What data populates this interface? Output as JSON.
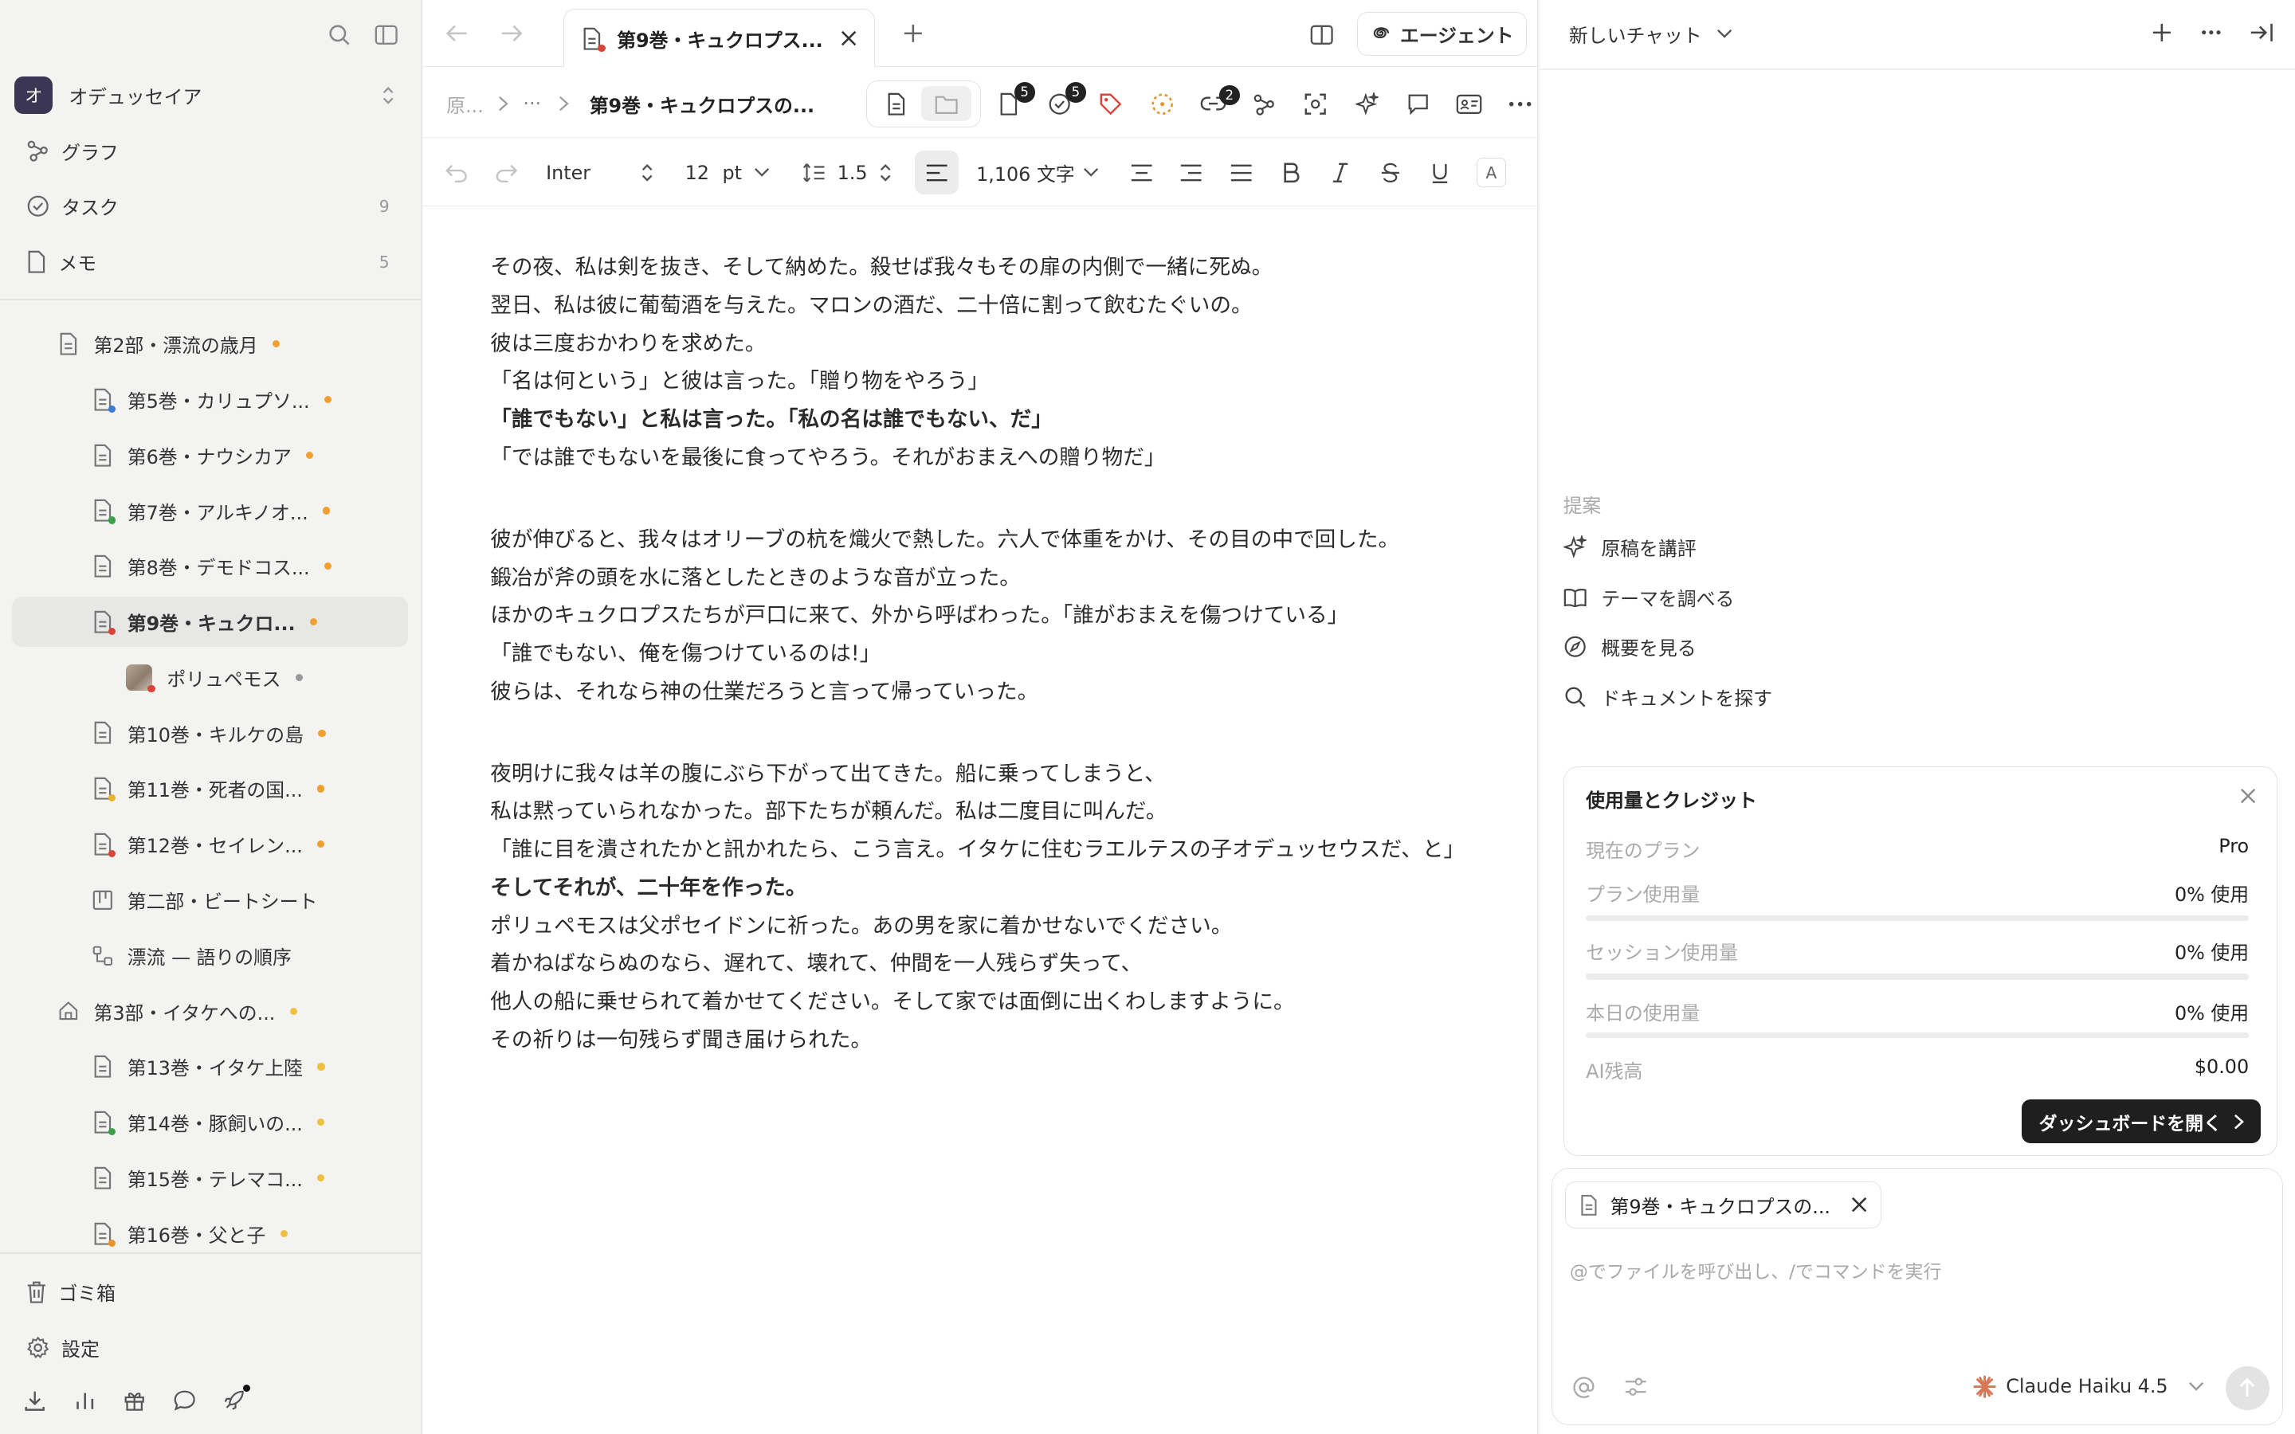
{
  "sidebar": {
    "workspace": {
      "initial": "オ",
      "name": "オデュッセイア"
    },
    "nav": [
      {
        "label": "グラフ",
        "count": ""
      },
      {
        "label": "タスク",
        "count": "9"
      },
      {
        "label": "メモ",
        "count": "5"
      }
    ],
    "tree": [
      {
        "label": "第2部・漂流の歳月",
        "dot": "#f0a030"
      },
      {
        "label": "第5巻・カリュプソ...",
        "dot": "#f0a030"
      },
      {
        "label": "第6巻・ナウシカア",
        "dot": "#f0a030"
      },
      {
        "label": "第7巻・アルキノオ...",
        "dot": "#f0a030"
      },
      {
        "label": "第8巻・デモドコス...",
        "dot": "#f0a030"
      },
      {
        "label": "第9巻・キュクロ...",
        "dot": "#f0a030"
      },
      {
        "label": "ポリュペモス",
        "dot": "#999999"
      },
      {
        "label": "第10巻・キルケの島",
        "dot": "#f0a030"
      },
      {
        "label": "第11巻・死者の国...",
        "dot": "#f0a030"
      },
      {
        "label": "第12巻・セイレン...",
        "dot": "#f0a030"
      },
      {
        "label": "第二部・ビートシート",
        "dot": ""
      },
      {
        "label": "漂流 — 語りの順序",
        "dot": ""
      },
      {
        "label": "第3部・イタケへの...",
        "dot": "#f0c040"
      },
      {
        "label": "第13巻・イタケ上陸",
        "dot": "#f0c040"
      },
      {
        "label": "第14巻・豚飼いの...",
        "dot": "#f0c040"
      },
      {
        "label": "第15巻・テレマコ...",
        "dot": "#f0c040"
      },
      {
        "label": "第16巻・父と子",
        "dot": "#f0c040"
      }
    ],
    "bottom": [
      {
        "label": "ゴミ箱"
      },
      {
        "label": "設定"
      }
    ]
  },
  "tab": {
    "title": "第9巻・キュクロプス..."
  },
  "agent_label": "エージェント",
  "breadcrumb": {
    "root": "原...",
    "ellipsis": "···",
    "current": "第9巻・キュクロプスの..."
  },
  "toolbar": {
    "badges": {
      "docs": "5",
      "tasks": "5",
      "links": "2"
    },
    "font": "Inter",
    "size": "12",
    "unit": "pt",
    "line_height": "1.5",
    "word_count": "1,106 文字"
  },
  "editor": {
    "block1": [
      "その夜、私は剣を抜き、そして納めた。殺せば我々もその扉の内側で一緒に死ぬ。",
      "翌日、私は彼に葡萄酒を与えた。マロンの酒だ、二十倍に割って飲むたぐいの。",
      "彼は三度おかわりを求めた。",
      "「名は何という」と彼は言った。「贈り物をやろう」",
      "「誰でもない」と私は言った。「私の名は誰でもない、だ」",
      "「では誰でもないを最後に食ってやろう。それがおまえへの贈り物だ」"
    ],
    "block2": [
      "彼が伸びると、我々はオリーブの杭を熾火で熱した。六人で体重をかけ、その目の中で回した。",
      "鍛冶が斧の頭を水に落としたときのような音が立った。",
      "ほかのキュクロプスたちが戸口に来て、外から呼ばわった。「誰がおまえを傷つけている」",
      "「誰でもない、俺を傷つけているのは!」",
      "彼らは、それなら神の仕業だろうと言って帰っていった。"
    ],
    "block3": [
      "夜明けに我々は羊の腹にぶら下がって出てきた。船に乗ってしまうと、",
      "私は黙っていられなかった。部下たちが頼んだ。私は二度目に叫んだ。",
      "「誰に目を潰されたかと訊かれたら、こう言え。イタケに住むラエルテスの子オデュッセウスだ、と」",
      "そしてそれが、二十年を作った。",
      "ポリュペモスは父ポセイドンに祈った。あの男を家に着かせないでください。",
      "着かねばならぬのなら、遅れて、壊れて、仲間を一人残らず失って、",
      "他人の船に乗せられて着かせてください。そして家では面倒に出くわしますように。",
      "その祈りは一句残らず聞き届けられた。"
    ]
  },
  "chat": {
    "title": "新しいチャット",
    "suggest_header": "提案",
    "suggestions": [
      "原稿を講評",
      "テーマを調べる",
      "概要を見る",
      "ドキュメントを探す"
    ],
    "usage": {
      "title": "使用量とクレジット",
      "rows": [
        {
          "k": "現在のプラン",
          "v": "Pro"
        },
        {
          "k": "プラン使用量",
          "v": "0% 使用"
        },
        {
          "k": "セッション使用量",
          "v": "0% 使用"
        },
        {
          "k": "本日の使用量",
          "v": "0% 使用"
        },
        {
          "k": "AI残高",
          "v": "$0.00"
        }
      ],
      "button": "ダッシュボードを開く"
    },
    "attachment": "第9巻・キュクロプスの...",
    "placeholder": "@でファイルを呼び出し、/でコマンドを実行",
    "model": "Claude Haiku 4.5"
  }
}
